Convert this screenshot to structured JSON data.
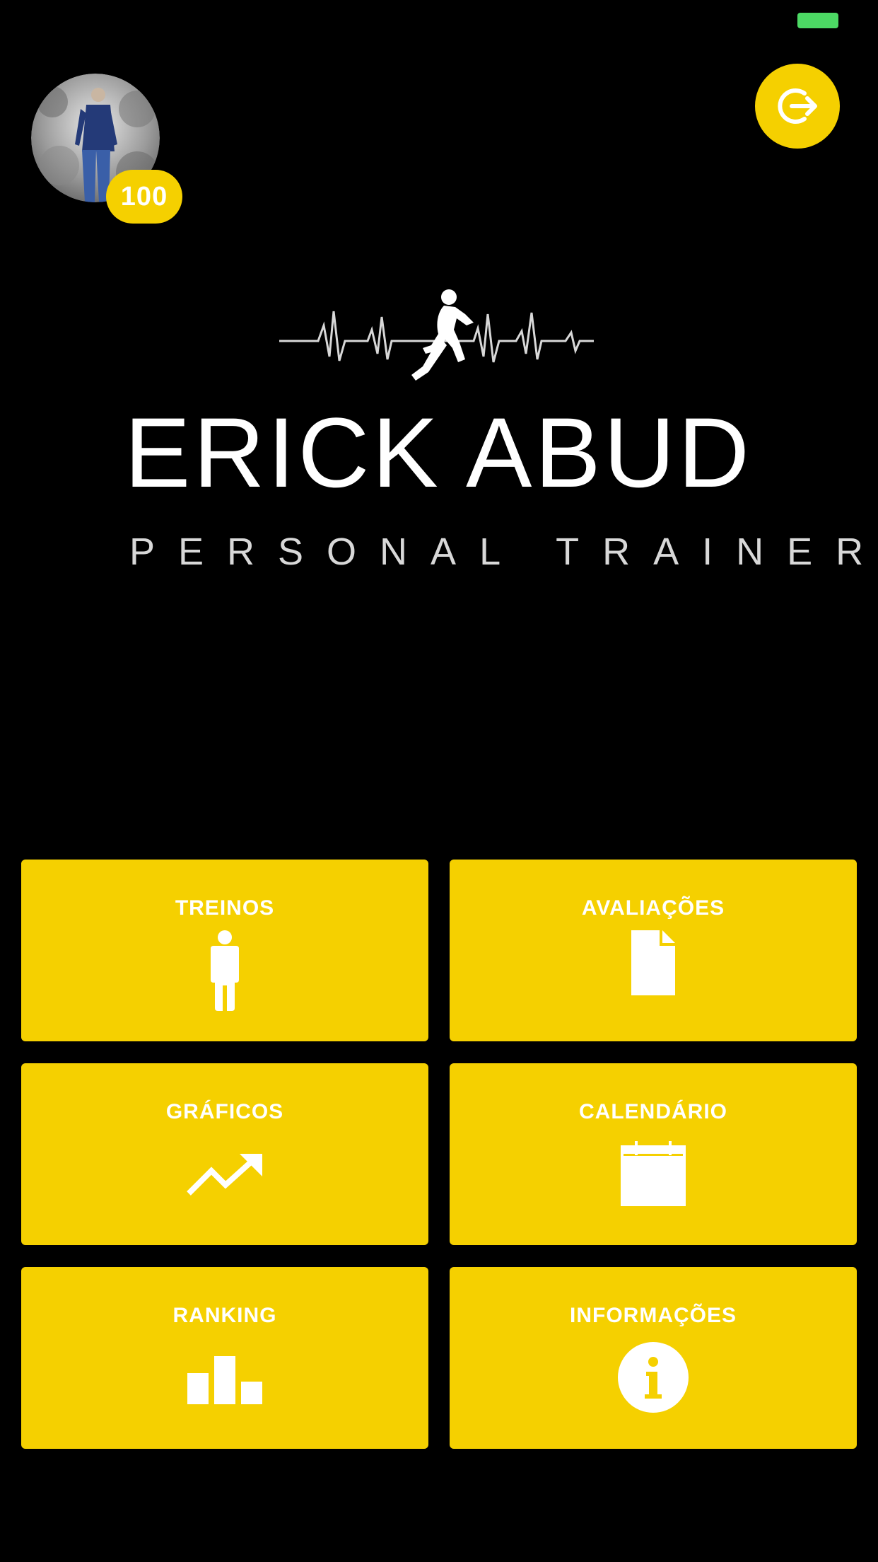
{
  "profile": {
    "points": "100"
  },
  "logo": {
    "name": "ERICK ABUD",
    "subtitle": "PERSONAL TRAINER"
  },
  "menu": {
    "treinos": "TREINOS",
    "avaliacoes": "AVALIAÇÕES",
    "graficos": "GRÁFICOS",
    "calendario": "CALENDÁRIO",
    "ranking": "RANKING",
    "informacoes": "INFORMAÇÕES"
  },
  "colors": {
    "accent": "#f5d000",
    "background": "#000000",
    "battery": "#4cd964"
  },
  "icons": {
    "treinos": "person-icon",
    "avaliacoes": "document-icon",
    "graficos": "trending-up-icon",
    "calendario": "calendar-icon",
    "ranking": "bar-chart-icon",
    "informacoes": "info-icon",
    "logout": "logout-icon"
  }
}
